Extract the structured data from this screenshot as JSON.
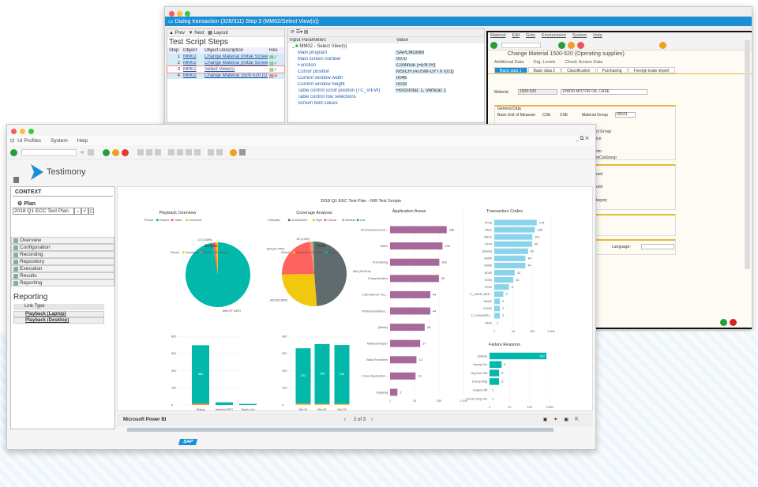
{
  "back_window": {
    "title": "Dialog transaction (326/311) Step 3 (MM02/Select View(s))",
    "toolbar": {
      "prev": "Prev",
      "next": "Next",
      "layout": "Layout"
    },
    "steps_title": "Test Script Steps",
    "columns": [
      "Step",
      "Object",
      "Object Description",
      "Res"
    ],
    "steps": [
      {
        "step": "1",
        "object": "MM02",
        "desc": "Change Material (Initial Screen)",
        "result": "passed"
      },
      {
        "step": "2",
        "object": "MM02",
        "desc": "Change Material (Initial Screen)",
        "result": "passed"
      },
      {
        "step": "3",
        "object": "MM02",
        "desc": "Select View(s)",
        "result": "passed"
      },
      {
        "step": "4",
        "object": "MM02",
        "desc": "Change Material 1500-520 (O...",
        "result": "failed"
      }
    ],
    "params_header": [
      "Input Parameters",
      "Value"
    ],
    "params_root": "MM02 - Select View(s)",
    "params": [
      {
        "name": "Main program",
        "value": "SAPLMGMM"
      },
      {
        "name": "Main screen number",
        "value": "0070"
      },
      {
        "name": "Function",
        "value": "Continue (=ENTR)"
      },
      {
        "name": "Cursor position",
        "value": "MSICHTAUSW-DYTXT(01)"
      },
      {
        "name": "Current window width",
        "value": "0046"
      },
      {
        "name": "Current window height",
        "value": "0018"
      },
      {
        "name": "Table control scroll position (TC_VIEW)",
        "value": "Horizontal: 1, Vertical: 1"
      },
      {
        "name": "Table control row selections",
        "value": ""
      },
      {
        "name": "Screen field values",
        "value": ""
      }
    ],
    "sap": {
      "menu": [
        "Material",
        "Edit",
        "Goto",
        "Environment",
        "System",
        "Help"
      ],
      "title": "Change Material 1500-520 (Operating supplies)",
      "actions": [
        "Additional Data",
        "Org. Levels",
        "Check Screen Data"
      ],
      "tabs": [
        "Basic data 1",
        "Basic data 2",
        "Classification",
        "Purchasing",
        "Foreign trade import"
      ],
      "material_label": "Material",
      "material_value": "1500-520",
      "material_desc": "10W30 MOTOR OIL CASE",
      "general_data": "General Data",
      "base_uom_label": "Base Unit of Measure",
      "base_uom_value": "CSE",
      "base_uom_text": "CSE",
      "material_group_label": "Material Group",
      "material_group_value": "00101",
      "partial_labels": [
        "ct Group",
        "ice",
        "om",
        "mCatGroup",
        "unit",
        "unit",
        "tegory"
      ],
      "language_label": "Language:"
    }
  },
  "front_window": {
    "menu": [
      "UI Profiles",
      "System",
      "Help"
    ],
    "brand": "Testimony",
    "context_title": "CONTEXT",
    "plan_label": "Plan",
    "plan_value": "2018 Q1 ECC Test Plan",
    "nav": [
      "Overview",
      "Configuration",
      "Recording",
      "Repository",
      "Execution",
      "Results",
      "Reporting"
    ],
    "reporting_title": "Reporting",
    "link_type_header": "Link Type",
    "links": [
      "Playback (Laptop)",
      "Playback (Desktop)"
    ],
    "report_title": "2018 Q1 EEC Test Plan - 699 Test Scripts",
    "footer": {
      "brand": "Microsoft Power BI",
      "page": "2 of 3"
    },
    "sap_logo": "SAP"
  },
  "colors": {
    "passed": "#01b8aa",
    "failed": "#fd625e",
    "canceled": "#f2c80f",
    "unclassified": "#5f6b6d",
    "medium": "#fe9666",
    "app": "#a66999",
    "tcode": "#8ad4eb",
    "accent": "#1a8fd6"
  },
  "chart_data": [
    {
      "type": "pie",
      "title": "Playback Overview",
      "legend_title": "Result",
      "legend_position": "top-left",
      "slices": [
        {
          "name": "Passed",
          "value": 696,
          "label": "696 (97.34%)"
        },
        {
          "name": "Failed",
          "value": 11,
          "label": "11 (1.54%)"
        },
        {
          "name": "Canceled",
          "value": 8,
          "label": ""
        }
      ]
    },
    {
      "type": "pie",
      "title": "Coverage Analysis",
      "legend_title": "Criticality",
      "legend_position": "top-left",
      "slices": [
        {
          "name": "Unclassified",
          "value": 642,
          "label": "642 (49.51%)"
        },
        {
          "name": "High",
          "value": 343,
          "label": "343 (25.65%)"
        },
        {
          "name": "Critical",
          "value": 304,
          "label": "304 (22.74%)"
        },
        {
          "name": "Medium",
          "value": 20,
          "label": "20 (1.5%)"
        },
        {
          "name": "Low",
          "value": 8,
          "label": ""
        }
      ]
    },
    {
      "type": "bar",
      "title": "Scripts",
      "legend_title": "Result",
      "legend": [
        "Canceled",
        "Failed",
        "Passed"
      ],
      "categories": [
        "Dialog",
        "Inbound RFC",
        "Batch Job"
      ],
      "series": [
        {
          "name": "Canceled",
          "values": [
            5,
            0,
            0
          ]
        },
        {
          "name": "Failed",
          "values": [
            10,
            0,
            0
          ]
        },
        {
          "name": "Passed",
          "values": [
            680,
            30,
            12
          ]
        }
      ],
      "data_labels": [
        "680",
        "",
        ""
      ],
      "ylim": [
        0,
        800
      ],
      "yticks": [
        0,
        200,
        400,
        600,
        800
      ],
      "grid": true
    },
    {
      "type": "bar",
      "title": "Bots",
      "legend_title": "Result",
      "legend": [
        "Canceled",
        "Failed",
        "Passed"
      ],
      "categories": [
        "Bot 01",
        "Bot 02",
        "Bot 03"
      ],
      "series": [
        {
          "name": "Canceled",
          "values": [
            5,
            4,
            4
          ]
        },
        {
          "name": "Failed",
          "values": [
            3,
            2,
            2
          ]
        },
        {
          "name": "Passed",
          "values": [
            322,
            348,
            343
          ]
        }
      ],
      "data_labels": [
        "322",
        "348",
        "343"
      ],
      "ylim": [
        0,
        400
      ],
      "yticks": [
        0,
        100,
        200,
        300,
        400
      ],
      "grid": true
    },
    {
      "type": "bar",
      "orientation": "horizontal",
      "title": "Application Areas",
      "x_scale": "log",
      "xticks": [
        "1",
        "10",
        "100",
        "1,000"
      ],
      "categories": [
        "Financial Accounti...",
        "Sales",
        "Purchasing",
        "Characteristics",
        "Client/Server Tec...",
        "Workload Balanci...",
        "(Blank)",
        "Material Master",
        "Basic Functions",
        "Cross-Application...",
        "Shipping"
      ],
      "values": [
        206,
        139,
        103,
        99,
        44,
        44,
        26,
        17,
        12,
        11,
        2
      ]
    },
    {
      "type": "bar",
      "orientation": "horizontal",
      "title": "Transaction Codes",
      "x_scale": "log",
      "xticks": [
        "1",
        "10",
        "100",
        "1,000"
      ],
      "categories": [
        "FK03",
        "VA01",
        "ME11",
        "CT04",
        "(Blank)",
        "SM50",
        "SM66",
        "XD02",
        "VD04",
        "FK02",
        "Z_USER_REP...",
        "MM02",
        "VL02N",
        "Z_CHANGED...",
        "VA02"
      ],
      "values": [
        174,
        138,
        101,
        99,
        61,
        44,
        44,
        12,
        10,
        6,
        3,
        2,
        2,
        2,
        1
      ]
    },
    {
      "type": "bar",
      "orientation": "horizontal",
      "title": "Failure Reasons",
      "x_scale": "log",
      "xticks": [
        "1",
        "10",
        "100",
        "1,000"
      ],
      "categories": [
        "(Blank)",
        "Unexp Scr",
        "Org Doc Diff",
        "Unexp Msg",
        "Output Diff",
        "Unexp Msg Job"
      ],
      "values": [
        697,
        4,
        3,
        3,
        1,
        1
      ]
    }
  ]
}
